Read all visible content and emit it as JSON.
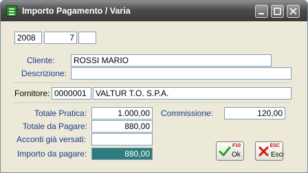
{
  "window": {
    "title": "Importo Pagamento / Varia",
    "controls": [
      "minimize-icon",
      "maximize-icon",
      "close-icon"
    ]
  },
  "header": {
    "year": "2008",
    "number": "7",
    "extra": ""
  },
  "cliente": {
    "label": "Cliente:",
    "value": "ROSSI MARIO"
  },
  "descrizione": {
    "label": "Descrizione:",
    "value": ""
  },
  "fornitore": {
    "label": "Fornitore:",
    "code": "0000001",
    "name": "VALTUR T.O. S.P.A."
  },
  "totali": {
    "totale_pratica_label": "Totale Pratica:",
    "totale_pratica": "1.000,00",
    "commissione_label": "Commissione:",
    "commissione": "120,00",
    "totale_da_pagare_label": "Totale da Pagare:",
    "totale_da_pagare": "880,00",
    "acconti_label": "Acconti già versati:",
    "acconti": "",
    "importo_label": "Importo da pagare:",
    "importo": "880,00"
  },
  "buttons": {
    "ok_key": "F10",
    "ok_label": "Ok",
    "esci_key": "ESC",
    "esci_label": "Esci"
  },
  "colors": {
    "title_bar": "#4b4b4b",
    "label_blue": "#1a3c8c",
    "highlight_field": "#2e7d7d"
  }
}
